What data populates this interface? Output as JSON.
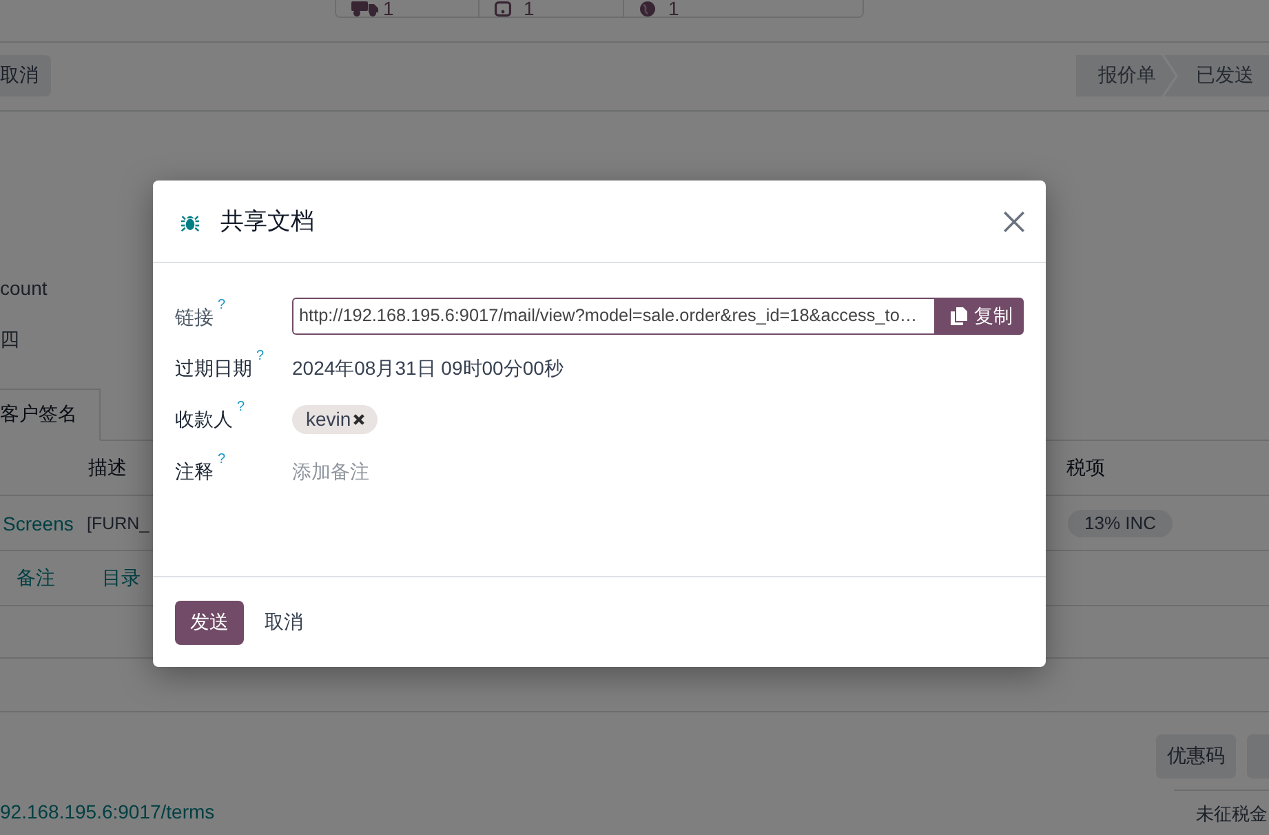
{
  "form": {
    "smart_buttons": [
      {
        "count": "1"
      },
      {
        "count": "1"
      },
      {
        "count": "1"
      }
    ],
    "action_buttons": [
      {
        "label": "取消"
      }
    ],
    "status_steps": [
      {
        "label": "报价单"
      },
      {
        "label": "已发送"
      }
    ],
    "field_texts": [
      "count",
      "四"
    ],
    "tabs": [
      {
        "label": "客户签名",
        "selected": true
      }
    ],
    "table": {
      "columns": [
        {
          "label": "描述"
        },
        {
          "label": "税项"
        }
      ],
      "rows": [
        {
          "kind": "product",
          "cells": [
            "Screens",
            "[FURN_"
          ],
          "taxes": [
            "13% INC"
          ]
        },
        {
          "kind": "links",
          "links": [
            "备注",
            "目录"
          ]
        }
      ]
    },
    "buttons": [
      "优惠码"
    ],
    "terms_link": "92.168.195.6:9017/terms",
    "totals": [
      {
        "label": "未征税金"
      }
    ]
  },
  "dialog": {
    "title": "共享文档",
    "fields": [
      {
        "kind": "link",
        "label": "链接",
        "help": "?",
        "value": "http://192.168.195.6:9017/mail/view?model=sale.order&res_id=18&access_to…",
        "button": "复制"
      },
      {
        "kind": "text",
        "label": "过期日期",
        "help": "?",
        "value": "2024年08月31日 09时00分00秒"
      },
      {
        "kind": "tags",
        "label": "收款人",
        "help": "?",
        "tags": [
          {
            "label": "kevin"
          }
        ]
      },
      {
        "kind": "note",
        "label": "注释",
        "help": "?",
        "placeholder": "添加备注"
      }
    ],
    "buttons": [
      {
        "kind": "primary",
        "label": "发送"
      },
      {
        "kind": "secondary",
        "label": "取消"
      }
    ]
  }
}
